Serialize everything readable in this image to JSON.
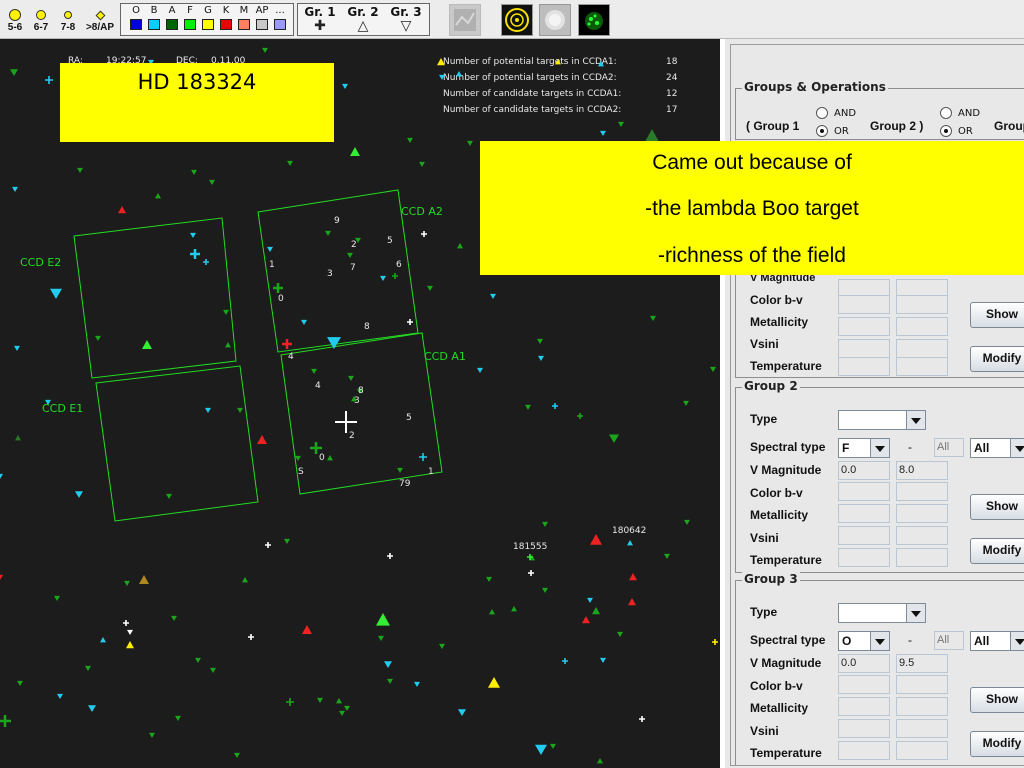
{
  "toolbar": {
    "magnitudes": [
      {
        "label": "5-6",
        "size": 10
      },
      {
        "label": "6-7",
        "size": 8
      },
      {
        "label": "7-8",
        "size": 6
      },
      {
        "label": ">8/AP",
        "size": 5
      }
    ],
    "spectral": [
      {
        "label": "O",
        "color": "#0000dd"
      },
      {
        "label": "B",
        "color": "#00d0ff"
      },
      {
        "label": "A",
        "color": "#006600"
      },
      {
        "label": "F",
        "color": "#00ee00"
      },
      {
        "label": "G",
        "color": "#ffff00"
      },
      {
        "label": "K",
        "color": "#ee0000"
      },
      {
        "label": "M",
        "color": "#ff8060"
      },
      {
        "label": "AP",
        "color": "#c8c8c8"
      },
      {
        "label": "...",
        "color": "#9999ff"
      }
    ],
    "groups": [
      {
        "label": "Gr. 1",
        "symbol": "✚"
      },
      {
        "label": "Gr. 2",
        "symbol": "△"
      },
      {
        "label": "Gr. 3",
        "symbol": "▽"
      }
    ]
  },
  "sky": {
    "ra_label": "RA:",
    "ra_value": "19:22:57",
    "dec_label": "DEC:",
    "dec_value": "0.11.00",
    "stats": [
      {
        "label": "Number of potential targets in CCDA1:",
        "value": "18"
      },
      {
        "label": "Number of potential targets in CCDA2:",
        "value": "24"
      },
      {
        "label": "Number of candidate targets in CCDA1:",
        "value": "12"
      },
      {
        "label": "Number of candidate targets in CCDA2:",
        "value": "17"
      }
    ],
    "target_name": "HD 183324",
    "ccd_labels": {
      "a2": "CCD A2",
      "a1": "CCD A1",
      "e2": "CCD E2",
      "e1": "CCD E1"
    },
    "star_ids": [
      "181555",
      "180642"
    ]
  },
  "note": {
    "lines": [
      "Came out because of",
      "-the lambda Boo target",
      "-richness of the field"
    ]
  },
  "panel": {
    "ops": {
      "title": "Groups & Operations",
      "group1": "( Group 1",
      "group2": "Group 2 )",
      "group3": "Group",
      "and": "AND",
      "or": "OR"
    },
    "field_labels": {
      "type": "Type",
      "spectral": "Spectral type",
      "vmag": "V Magnitude",
      "color": "Color b-v",
      "metal": "Metallicity",
      "vsini": "Vsini",
      "temp": "Temperature"
    },
    "dash": "-",
    "buttons": {
      "show": "Show",
      "modify": "Modify"
    },
    "group1_partial": {
      "vmag_hidden_label": "V Magnitude"
    },
    "group2": {
      "title": "Group 2",
      "spectral_from": "F",
      "spectral_to_placeholder": "All",
      "spectral_to": "All",
      "vmag_min": "0.0",
      "vmag_max": "8.0"
    },
    "group3": {
      "title": "Group 3",
      "spectral_from": "O",
      "spectral_to_placeholder": "All",
      "spectral_to": "All",
      "vmag_min": "0.0",
      "vmag_max": "9.5"
    }
  }
}
